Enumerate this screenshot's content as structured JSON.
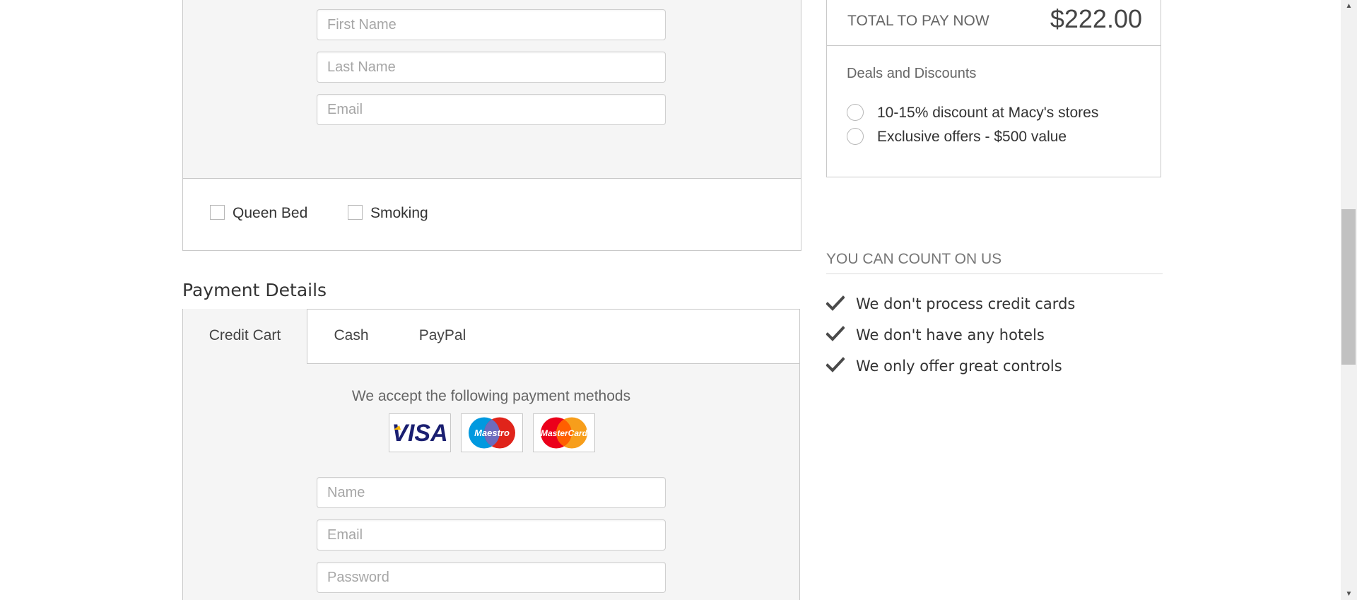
{
  "guest_form": {
    "first_name_placeholder": "First Name",
    "last_name_placeholder": "Last Name",
    "email_placeholder": "Email"
  },
  "room_options": {
    "queen_bed_label": "Queen Bed",
    "smoking_label": "Smoking"
  },
  "payment": {
    "section_title": "Payment Details",
    "tabs": [
      {
        "label": "Credit Cart",
        "active": true
      },
      {
        "label": "Cash",
        "active": false
      },
      {
        "label": "PayPal",
        "active": false
      }
    ],
    "accept_text": "We accept the following payment methods",
    "cards": [
      "VISA",
      "Maestro",
      "MasterCard"
    ],
    "name_placeholder": "Name",
    "email_placeholder": "Email",
    "password_placeholder": "Password"
  },
  "summary": {
    "total_label": "TOTAL TO PAY NOW",
    "total_value": "$222.00",
    "deals_title": "Deals and Discounts",
    "deals": [
      "10-15% discount at Macy's stores",
      "Exclusive offers - $500 value"
    ]
  },
  "trust": {
    "title": "YOU CAN COUNT ON US",
    "items": [
      "We don't process credit cards",
      "We don't have any hotels",
      "We only offer great controls"
    ]
  },
  "colors": {
    "panel_bg": "#f5f5f5",
    "border": "#c9c9c9",
    "visa_blue": "#1a1f71",
    "visa_gold": "#f7b600",
    "maestro_blue": "#0099df",
    "maestro_red": "#e0241b",
    "mastercard_red": "#eb001b",
    "mastercard_orange": "#f79e1b"
  }
}
